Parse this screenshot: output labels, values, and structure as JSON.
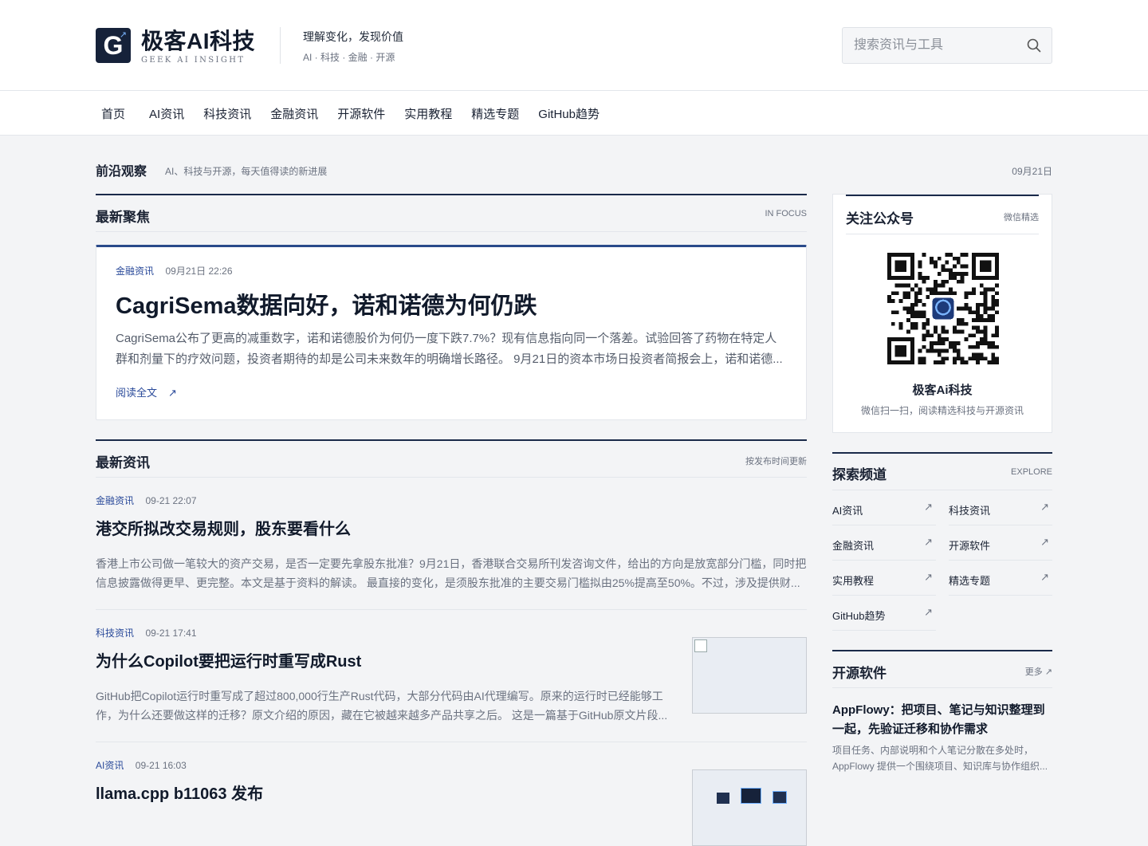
{
  "brand": {
    "logo_letter": "G",
    "title": "极客AI科技",
    "subtitle": "GEEK AI INSIGHT",
    "slogan": "理解变化，发现价值",
    "slogan_sub": "AI · 科技 · 金融 · 开源"
  },
  "search": {
    "placeholder": "搜索资讯与工具"
  },
  "nav": {
    "items": [
      {
        "label": "首页"
      },
      {
        "label": "AI资讯"
      },
      {
        "label": "科技资讯"
      },
      {
        "label": "金融资讯"
      },
      {
        "label": "开源软件"
      },
      {
        "label": "实用教程"
      },
      {
        "label": "精选专题"
      },
      {
        "label": "GitHub趋势"
      }
    ]
  },
  "frontier": {
    "title": "前沿观察",
    "desc": "AI、科技与开源，每天值得读的新进展",
    "date": "09月21日"
  },
  "focus": {
    "title": "最新聚焦",
    "right": "IN FOCUS",
    "article": {
      "tag": "金融资讯",
      "time": "09月21日 22:26",
      "headline": "CagriSema数据向好，诺和诺德为何仍跌",
      "excerpt": "CagriSema公布了更高的减重数字，诺和诺德股价为何仍一度下跌7.7%？现有信息指向同一个落差。试验回答了药物在特定人群和剂量下的疗效问题，投资者期待的却是公司未来数年的明确增长路径。 9月21日的资本市场日投资者简报会上，诺和诺德...",
      "read_more": "阅读全文",
      "arrow": "↗"
    }
  },
  "latest": {
    "title": "最新资讯",
    "right": "按发布时间更新",
    "items": [
      {
        "tag": "金融资讯",
        "time": "09-21 22:07",
        "headline": "港交所拟改交易规则，股东要看什么",
        "excerpt": "香港上市公司做一笔较大的资产交易，是否一定要先拿股东批准？9月21日，香港联合交易所刊发咨询文件，给出的方向是放宽部分门槛，同时把信息披露做得更早、更完整。本文是基于资料的解读。 最直接的变化，是须股东批准的主要交易门槛拟由25%提高至50%。不过，涉及提供财..."
      },
      {
        "tag": "科技资讯",
        "time": "09-21 17:41",
        "headline": "为什么Copilot要把运行时重写成Rust",
        "excerpt": "GitHub把Copilot运行时重写成了超过800,000行生产Rust代码，大部分代码由AI代理编写。原来的运行时已经能够工作，为什么还要做这样的迁移？原文介绍的原因，藏在它被越来越多产品共享之后。 这是一篇基于GitHub原文片段..."
      },
      {
        "tag": "AI资讯",
        "time": "09-21 16:03",
        "headline": "llama.cpp b11063 发布",
        "excerpt": ""
      }
    ]
  },
  "wechat": {
    "title": "关注公众号",
    "right": "微信精选",
    "name": "极客Ai科技",
    "desc": "微信扫一扫，阅读精选科技与开源资讯"
  },
  "explore": {
    "title": "探索频道",
    "right": "EXPLORE",
    "arrow": "↗",
    "items": [
      {
        "label": "AI资讯"
      },
      {
        "label": "科技资讯"
      },
      {
        "label": "金融资讯"
      },
      {
        "label": "开源软件"
      },
      {
        "label": "实用教程"
      },
      {
        "label": "精选专题"
      },
      {
        "label": "GitHub趋势"
      }
    ]
  },
  "oss": {
    "title": "开源软件",
    "right": "更多 ↗",
    "item": {
      "headline": "AppFlowy：把项目、笔记与知识整理到一起，先验证迁移和协作需求",
      "excerpt": "项目任务、内部说明和个人笔记分散在多处时，AppFlowy 提供一个围绕项目、知识库与协作组织..."
    }
  }
}
